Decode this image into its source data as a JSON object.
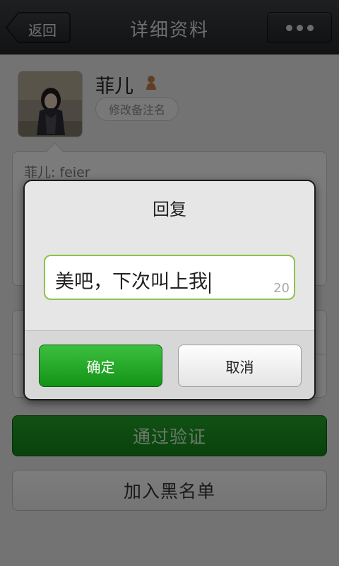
{
  "header": {
    "back_label": "返回",
    "title": "详细资料",
    "more_icon": "more-dots-icon"
  },
  "profile": {
    "name": "菲儿",
    "gender_icon": "female-icon",
    "remark_button": "修改备注名",
    "message": "菲儿: feier"
  },
  "actions": {
    "pass_button": "通过验证",
    "blacklist_button": "加入黑名单"
  },
  "dialog": {
    "title": "回复",
    "input_value": "美吧，下次叫上我",
    "char_counter": "20",
    "ok_button": "确定",
    "cancel_button": "取消"
  },
  "colors": {
    "accent_green": "#139317",
    "input_border": "#8ac44b",
    "titlebar": "#2b2e30"
  }
}
